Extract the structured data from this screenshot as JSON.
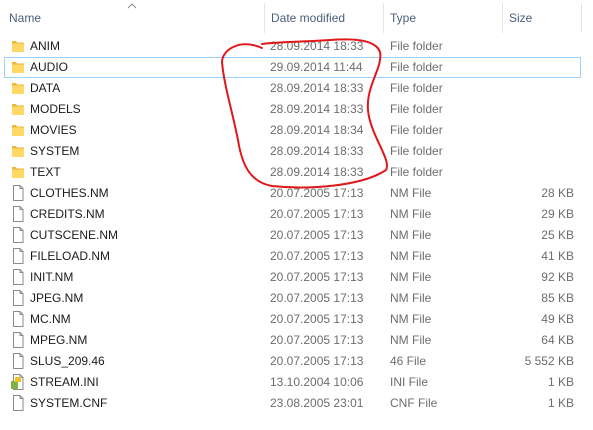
{
  "columns": {
    "name": "Name",
    "date": "Date modified",
    "type": "Type",
    "size": "Size"
  },
  "files": [
    {
      "name": "ANIM",
      "date": "28.09.2014 18:33",
      "type": "File folder",
      "size": "",
      "icon": "folder-icon"
    },
    {
      "name": "AUDIO",
      "date": "29.09.2014 11:44",
      "type": "File folder",
      "size": "",
      "icon": "folder-icon",
      "selected": true
    },
    {
      "name": "DATA",
      "date": "28.09.2014 18:33",
      "type": "File folder",
      "size": "",
      "icon": "folder-icon"
    },
    {
      "name": "MODELS",
      "date": "28.09.2014 18:33",
      "type": "File folder",
      "size": "",
      "icon": "folder-icon"
    },
    {
      "name": "MOVIES",
      "date": "28.09.2014 18:34",
      "type": "File folder",
      "size": "",
      "icon": "folder-icon"
    },
    {
      "name": "SYSTEM",
      "date": "28.09.2014 18:33",
      "type": "File folder",
      "size": "",
      "icon": "folder-icon"
    },
    {
      "name": "TEXT",
      "date": "28.09.2014 18:33",
      "type": "File folder",
      "size": "",
      "icon": "folder-icon"
    },
    {
      "name": "CLOTHES.NM",
      "date": "20.07.2005 17:13",
      "type": "NM File",
      "size": "28 KB",
      "icon": "file-icon"
    },
    {
      "name": "CREDITS.NM",
      "date": "20.07.2005 17:13",
      "type": "NM File",
      "size": "29 KB",
      "icon": "file-icon"
    },
    {
      "name": "CUTSCENE.NM",
      "date": "20.07.2005 17:13",
      "type": "NM File",
      "size": "25 KB",
      "icon": "file-icon"
    },
    {
      "name": "FILELOAD.NM",
      "date": "20.07.2005 17:13",
      "type": "NM File",
      "size": "41 KB",
      "icon": "file-icon"
    },
    {
      "name": "INIT.NM",
      "date": "20.07.2005 17:13",
      "type": "NM File",
      "size": "92 KB",
      "icon": "file-icon"
    },
    {
      "name": "JPEG.NM",
      "date": "20.07.2005 17:13",
      "type": "NM File",
      "size": "85 KB",
      "icon": "file-icon"
    },
    {
      "name": "MC.NM",
      "date": "20.07.2005 17:13",
      "type": "NM File",
      "size": "49 KB",
      "icon": "file-icon"
    },
    {
      "name": "MPEG.NM",
      "date": "20.07.2005 17:13",
      "type": "NM File",
      "size": "64 KB",
      "icon": "file-icon"
    },
    {
      "name": "SLUS_209.46",
      "date": "20.07.2005 17:13",
      "type": "46 File",
      "size": "5 552 KB",
      "icon": "file-icon"
    },
    {
      "name": "STREAM.INI",
      "date": "13.10.2004 10:06",
      "type": "INI File",
      "size": "1 KB",
      "icon": "ini-file-icon"
    },
    {
      "name": "SYSTEM.CNF",
      "date": "23.08.2005 23:01",
      "type": "CNF File",
      "size": "1 KB",
      "icon": "file-icon"
    }
  ],
  "colors": {
    "header_text": "#4c607a",
    "folder_body": "#ffd866",
    "folder_tab": "#e8b73c",
    "selection_border": "#99d1ff",
    "annotation_stroke": "#e0181b"
  }
}
